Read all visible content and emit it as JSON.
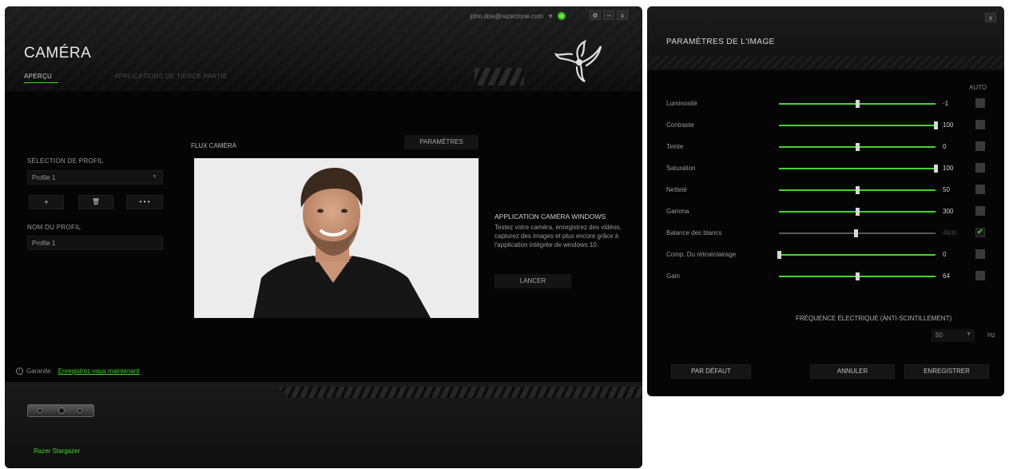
{
  "main": {
    "account": "john.doe@razerzone.com",
    "window_buttons": [
      "⚙",
      "–",
      "x"
    ],
    "title": "CAMÉRA",
    "tabs": [
      {
        "label": "APERÇU",
        "active": true
      },
      {
        "label": "APPLICATIONS DE TIERCE PARTIE",
        "active": false
      }
    ],
    "profile": {
      "selection_label": "SÉLECTION DE PROFIL",
      "selected": "Profile 1",
      "add_label": "+",
      "delete_label": "🗑",
      "more_label": "• • •",
      "name_label": "NOM DU PROFIL",
      "name_value": "Profile 1"
    },
    "camera": {
      "flux_label": "FLUX CAMÉRA",
      "params_button": "PARAMÈTRES"
    },
    "windows_app": {
      "title": "APPLICATION CAMÉRA WINDOWS",
      "description": "Testez votre caméra, enregistrez des vidéos, capturez des images et plus encore grâce à l'application intégrée de windows 10.",
      "launch_button": "LANCER"
    },
    "warranty": {
      "label": "Garantie",
      "link": "Enregistrez-vous maintenant"
    },
    "device_name": "Razer Stargazer"
  },
  "side": {
    "close": "x",
    "title": "PARAMÈTRES DE L'IMAGE",
    "auto_label": "AUTO",
    "sliders": [
      {
        "name": "Luminosité",
        "value": "-1",
        "fraction": 0.5,
        "auto": false,
        "enabled": true
      },
      {
        "name": "Contraste",
        "value": "100",
        "fraction": 1.0,
        "auto": false,
        "enabled": true
      },
      {
        "name": "Teinte",
        "value": "0",
        "fraction": 0.5,
        "auto": false,
        "enabled": true
      },
      {
        "name": "Saturation",
        "value": "100",
        "fraction": 1.0,
        "auto": false,
        "enabled": true
      },
      {
        "name": "Netteté",
        "value": "50",
        "fraction": 0.5,
        "auto": false,
        "enabled": true
      },
      {
        "name": "Gamma",
        "value": "300",
        "fraction": 0.5,
        "auto": false,
        "enabled": true
      },
      {
        "name": "Balance des blancs",
        "value": "4600",
        "fraction": 0.49,
        "auto": true,
        "enabled": false
      },
      {
        "name": "Comp. Du rétroéclairage",
        "value": "0",
        "fraction": 0.0,
        "auto": false,
        "enabled": true
      },
      {
        "name": "Gain",
        "value": "64",
        "fraction": 0.5,
        "auto": false,
        "enabled": true
      }
    ],
    "frequency": {
      "label": "FRÉQUENCE ÉLECTRIQUE (ANTI-SCINTILLEMENT)",
      "value": "50",
      "unit": "Hz"
    },
    "buttons": {
      "default": "PAR DÉFAUT",
      "cancel": "ANNULER",
      "save": "ENREGISTRER"
    }
  },
  "colors": {
    "accent": "#44d62c",
    "background": "#050505"
  }
}
